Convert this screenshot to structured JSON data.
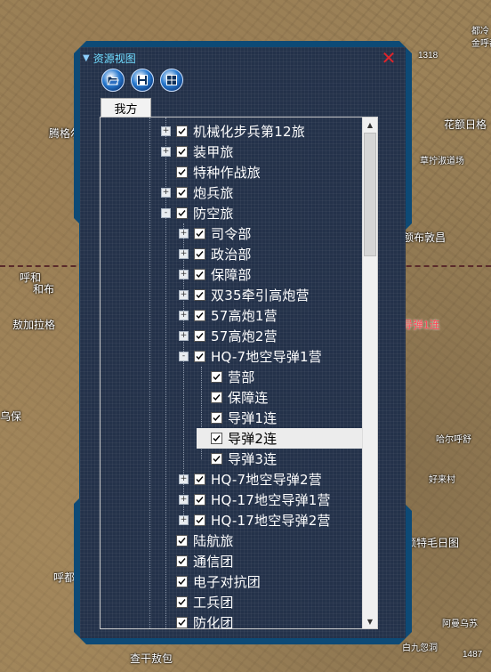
{
  "map": {
    "labels": [
      {
        "text": "都冷",
        "cls": "small"
      },
      {
        "text": "金呼都日",
        "cls": "small"
      },
      {
        "text": "1318",
        "cls": "small"
      },
      {
        "text": "腾格尔",
        "cls": ""
      },
      {
        "text": "花额日格",
        "cls": ""
      },
      {
        "text": "草拧淑道场",
        "cls": "small"
      },
      {
        "text": "呼和",
        "cls": ""
      },
      {
        "text": "和布",
        "cls": ""
      },
      {
        "text": "敖加拉格",
        "cls": ""
      },
      {
        "text": "额布敦昌",
        "cls": ""
      },
      {
        "text": "导弹1连",
        "cls": "red"
      },
      {
        "text": "乌保",
        "cls": ""
      },
      {
        "text": "哈尔呼舒",
        "cls": "small"
      },
      {
        "text": "好来村",
        "cls": "small"
      },
      {
        "text": "额特毛日图",
        "cls": ""
      },
      {
        "text": "呼都日",
        "cls": ""
      },
      {
        "text": "阿曼乌苏",
        "cls": "small"
      },
      {
        "text": "查干敖包",
        "cls": ""
      },
      {
        "text": "白九忽洞",
        "cls": "small"
      },
      {
        "text": "1487",
        "cls": "small"
      }
    ]
  },
  "panel": {
    "title": "资源视图",
    "tab": "我方",
    "toolbar": [
      "open-folder-icon",
      "save-icon",
      "grid-icon"
    ]
  },
  "tree": [
    {
      "label": "机械化步兵第12旅",
      "level": 0,
      "expander": "+",
      "checked": true
    },
    {
      "label": "装甲旅",
      "level": 0,
      "expander": "+",
      "checked": true
    },
    {
      "label": "特种作战旅",
      "level": 0,
      "expander": "",
      "checked": true
    },
    {
      "label": "炮兵旅",
      "level": 0,
      "expander": "+",
      "checked": true
    },
    {
      "label": "防空旅",
      "level": 0,
      "expander": "-",
      "checked": true
    },
    {
      "label": "司令部",
      "level": 1,
      "expander": "+",
      "checked": true
    },
    {
      "label": "政治部",
      "level": 1,
      "expander": "+",
      "checked": true
    },
    {
      "label": "保障部",
      "level": 1,
      "expander": "+",
      "checked": true
    },
    {
      "label": "双35牵引高炮营",
      "level": 1,
      "expander": "+",
      "checked": true
    },
    {
      "label": "57高炮1营",
      "level": 1,
      "expander": "+",
      "checked": true
    },
    {
      "label": "57高炮2营",
      "level": 1,
      "expander": "+",
      "checked": true
    },
    {
      "label": "HQ-7地空导弹1营",
      "level": 1,
      "expander": "-",
      "checked": true
    },
    {
      "label": "营部",
      "level": 2,
      "expander": "",
      "checked": true
    },
    {
      "label": "保障连",
      "level": 2,
      "expander": "",
      "checked": true
    },
    {
      "label": "导弹1连",
      "level": 2,
      "expander": "",
      "checked": true
    },
    {
      "label": "导弹2连",
      "level": 2,
      "expander": "",
      "checked": true,
      "selected": true
    },
    {
      "label": "导弹3连",
      "level": 2,
      "expander": "",
      "checked": true
    },
    {
      "label": "HQ-7地空导弹2营",
      "level": 1,
      "expander": "+",
      "checked": true
    },
    {
      "label": "HQ-17地空导弹1营",
      "level": 1,
      "expander": "+",
      "checked": true
    },
    {
      "label": "HQ-17地空导弹2营",
      "level": 1,
      "expander": "+",
      "checked": true
    },
    {
      "label": "陆航旅",
      "level": 0,
      "expander": "",
      "checked": true
    },
    {
      "label": "通信团",
      "level": 0,
      "expander": "",
      "checked": true
    },
    {
      "label": "电子对抗团",
      "level": 0,
      "expander": "",
      "checked": true
    },
    {
      "label": "工兵团",
      "level": 0,
      "expander": "",
      "checked": true
    },
    {
      "label": "防化团",
      "level": 0,
      "expander": "",
      "checked": true
    }
  ],
  "colors": {
    "panel_border": "#0d4a76",
    "panel_bg": "#24324a",
    "title": "#6fdcff",
    "close": "#e0242a"
  }
}
